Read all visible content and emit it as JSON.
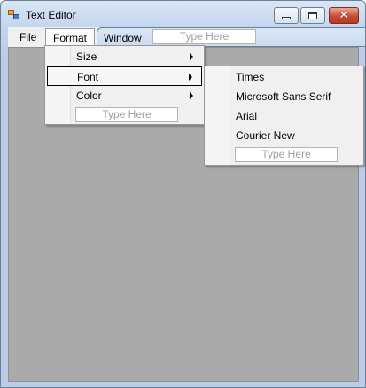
{
  "window": {
    "title": "Text Editor"
  },
  "titlebar": {
    "close_glyph": "✕"
  },
  "menubar": {
    "items": [
      {
        "label": "File"
      },
      {
        "label": "Format"
      },
      {
        "label": "Window"
      }
    ],
    "type_here": "Type Here"
  },
  "format_menu": {
    "items": [
      {
        "label": "Size",
        "has_submenu": true
      },
      {
        "label": "Font",
        "has_submenu": true,
        "selected": true
      },
      {
        "label": "Color",
        "has_submenu": true
      }
    ],
    "type_here": "Type Here"
  },
  "font_menu": {
    "items": [
      {
        "label": "Times"
      },
      {
        "label": "Microsoft Sans Serif"
      },
      {
        "label": "Arial"
      },
      {
        "label": "Courier New"
      }
    ],
    "type_here": "Type Here"
  },
  "icons": {
    "app": "app-icon",
    "minimize": "minimize-icon",
    "maximize": "maximize-icon",
    "close": "close-icon",
    "submenu": "chevron-right-icon"
  }
}
